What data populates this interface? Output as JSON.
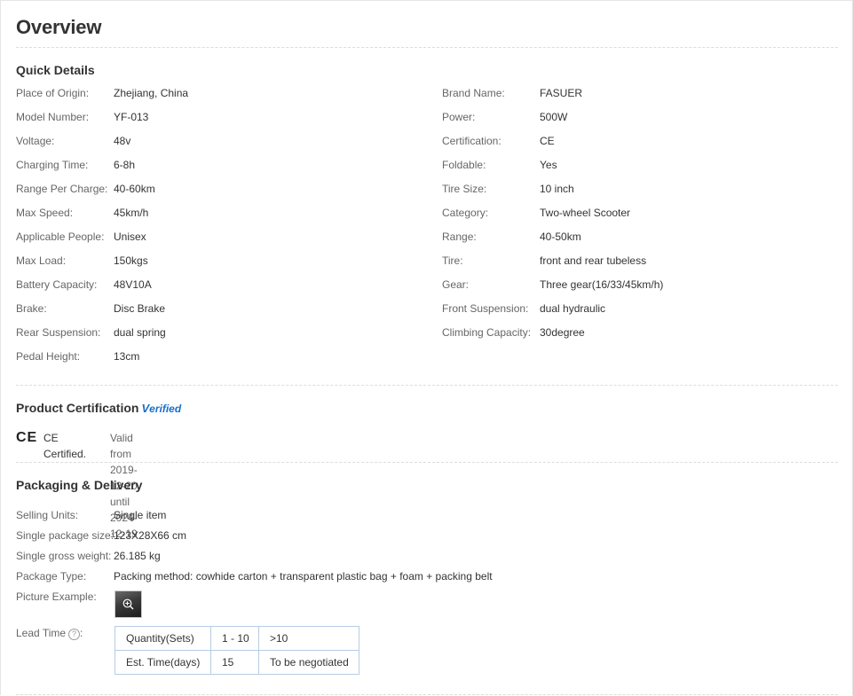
{
  "page_title": "Overview",
  "quick_details": {
    "heading": "Quick Details",
    "left": [
      {
        "label": "Place of Origin:",
        "value": "Zhejiang, China"
      },
      {
        "label": "Model Number:",
        "value": "YF-013"
      },
      {
        "label": "Voltage:",
        "value": "48v"
      },
      {
        "label": "Charging Time:",
        "value": "6-8h"
      },
      {
        "label": "Range Per Charge:",
        "value": "40-60km"
      },
      {
        "label": "Max Speed:",
        "value": "45km/h"
      },
      {
        "label": "Applicable People:",
        "value": "Unisex"
      },
      {
        "label": "Max Load:",
        "value": "150kgs"
      },
      {
        "label": "Battery Capacity:",
        "value": "48V10A"
      },
      {
        "label": "Brake:",
        "value": "Disc Brake"
      },
      {
        "label": "Rear Suspension:",
        "value": "dual spring"
      },
      {
        "label": "Pedal Height:",
        "value": "13cm"
      }
    ],
    "right": [
      {
        "label": "Brand Name:",
        "value": "FASUER"
      },
      {
        "label": "Power:",
        "value": "500W"
      },
      {
        "label": "Certification:",
        "value": "CE"
      },
      {
        "label": "Foldable:",
        "value": "Yes"
      },
      {
        "label": "Tire Size:",
        "value": "10 inch"
      },
      {
        "label": "Category:",
        "value": "Two-wheel Scooter"
      },
      {
        "label": "Range:",
        "value": "40-50km"
      },
      {
        "label": "Tire:",
        "value": "front and rear tubeless"
      },
      {
        "label": "Gear:",
        "value": "Three gear(16/33/45km/h)"
      },
      {
        "label": "Front Suspension:",
        "value": "dual hydraulic"
      },
      {
        "label": "Climbing Capacity:",
        "value": "30degree"
      }
    ]
  },
  "certification": {
    "heading": "Product Certification",
    "verified_v": "V",
    "verified_rest": "erified",
    "mark": "CE",
    "name": "CE Certified.",
    "validity": "Valid from 2019-12-20 until 2024-12-19"
  },
  "packaging": {
    "heading": "Packaging & Delivery",
    "rows": [
      {
        "label": "Selling Units:",
        "value": "Single item"
      },
      {
        "label": "Single package size:",
        "value": "123X28X66 cm"
      },
      {
        "label": "Single gross weight:",
        "value": "26.185 kg"
      },
      {
        "label": "Package Type:",
        "value": "Packing method: cowhide carton + transparent plastic bag + foam + packing belt"
      }
    ],
    "picture_label": "Picture Example:",
    "lead_time_label": "Lead Time",
    "help_glyph": "?",
    "lead_table": {
      "row1": [
        "Quantity(Sets)",
        "1 - 10",
        ">10"
      ],
      "row2": [
        "Est. Time(days)",
        "15",
        "To be negotiated"
      ]
    }
  },
  "colors": {
    "verified": "#1a6fc9",
    "table_border": "#b8cce4",
    "label": "#666666"
  },
  "icons": [
    "zoom-in-icon",
    "help-circle-icon",
    "ce-mark-icon"
  ]
}
